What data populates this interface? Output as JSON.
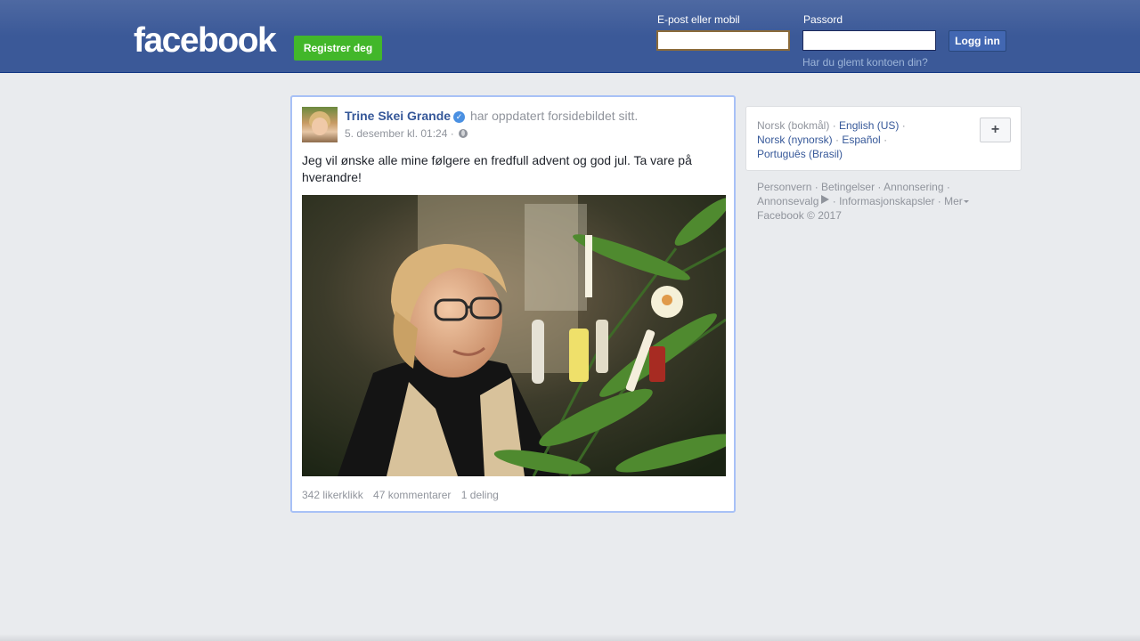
{
  "header": {
    "logo": "facebook",
    "register_label": "Registrer deg",
    "email_label": "E-post eller mobil",
    "password_label": "Passord",
    "login_label": "Logg inn",
    "forgot_label": "Har du glemt kontoen din?"
  },
  "post": {
    "author": "Trine Skei Grande",
    "action": "har oppdatert forsidebildet sitt.",
    "timestamp": "5. desember kl. 01:24",
    "text": "Jeg vil ønske alle mine følgere en fredfull advent og god jul. Ta vare på hverandre!",
    "likes": "342 likerklikk",
    "comments": "47 kommentarer",
    "shares": "1 deling"
  },
  "sidebar": {
    "languages": {
      "current": "Norsk (bokmål)",
      "english": "English (US)",
      "nynorsk": "Norsk (nynorsk)",
      "spanish": "Español",
      "portuguese": "Português (Brasil)"
    },
    "footer": {
      "privacy": "Personvern",
      "terms": "Betingelser",
      "ads": "Annonsering",
      "adchoices": "Annonsevalg",
      "cookies": "Informasjonskapsler",
      "more": "Mer",
      "copyright": "Facebook © 2017"
    }
  }
}
